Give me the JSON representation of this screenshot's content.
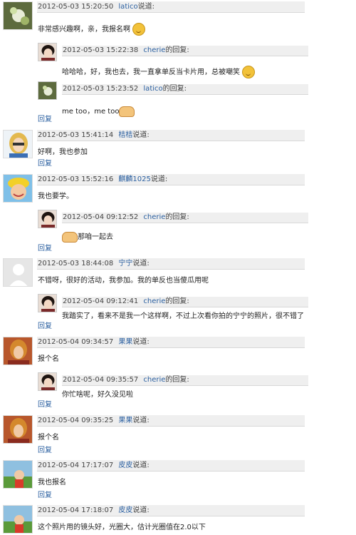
{
  "comments": [
    {
      "timestamp": "2012-05-03 15:20:50",
      "user": "latico",
      "action": "说道:",
      "text": "非常感兴趣啊，亲，我报名啊",
      "emoji": "smile-emoji",
      "replies": [
        {
          "timestamp": "2012-05-03 15:22:38",
          "user": "cherie",
          "action": "的回复:",
          "text": "哈哈哈，好，我也去，我一直拿单反当卡片用，总被嘲笑",
          "emoji": "smile-emoji"
        },
        {
          "timestamp": "2012-05-03 15:23:52",
          "user": "latico",
          "action": "的回复:",
          "text": "me too，me too",
          "emoji": "handshake-emoji"
        }
      ]
    },
    {
      "timestamp": "2012-05-03 15:41:14",
      "user": "桔桔",
      "action": "说道:",
      "text": "好啊，我也参加"
    },
    {
      "timestamp": "2012-05-03 15:52:16",
      "user": "麒麟1025",
      "action": "说道:",
      "text": "我也要学。",
      "replies": [
        {
          "timestamp": "2012-05-04 09:12:52",
          "user": "cherie",
          "action": "的回复:",
          "text": "那咱一起去",
          "emoji": "handshake-emoji"
        }
      ]
    },
    {
      "timestamp": "2012-05-03 18:44:08",
      "user": "宁宁",
      "action": "说道:",
      "text": "不错呀，很好的活动，我参加。我的单反也当傻瓜用呢",
      "replies": [
        {
          "timestamp": "2012-05-04 09:12:41",
          "user": "cherie",
          "action": "的回复:",
          "text": "我踏实了，看来不是我一个这样啊，不过上次看你拍的宁宁的照片，很不错了"
        }
      ]
    },
    {
      "timestamp": "2012-05-04 09:34:57",
      "user": "果果",
      "action": "说道:",
      "text": "报个名",
      "replies": [
        {
          "timestamp": "2012-05-04 09:35:57",
          "user": "cherie",
          "action": "的回复:",
          "text": "你忙啥呢，好久没见啦"
        }
      ]
    },
    {
      "timestamp": "2012-05-04 09:35:25",
      "user": "果果",
      "action": "说道:",
      "text": "报个名"
    },
    {
      "timestamp": "2012-05-04 17:17:07",
      "user": "皮皮",
      "action": "说道:",
      "text": "我也报名"
    },
    {
      "timestamp": "2012-05-04 17:18:07",
      "user": "皮皮",
      "action": "说道:",
      "text": "这个照片用的镜头好，光圈大，估计光圈值在2.0以下"
    }
  ],
  "reply_label": "回复"
}
